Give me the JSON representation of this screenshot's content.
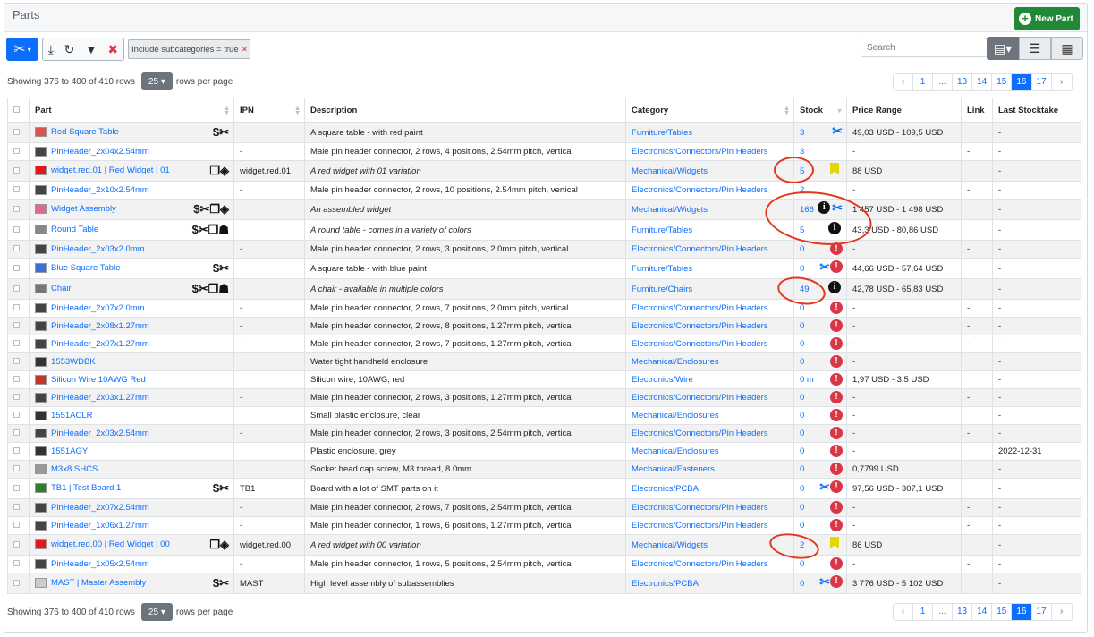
{
  "panel": {
    "title": "Parts",
    "new_part_label": "New Part"
  },
  "toolbar": {
    "filter_tag": "Include subcategories = true",
    "filter_tag_remove": "×"
  },
  "search": {
    "placeholder": "Search"
  },
  "pagination": {
    "showing_text": "Showing 376 to 400 of 410 rows",
    "page_size": "25",
    "rows_per_page_label": "rows per page",
    "pages": [
      "‹",
      "1",
      "...",
      "13",
      "14",
      "15",
      "16",
      "17",
      "›"
    ],
    "active_page": "16"
  },
  "columns": [
    "Part",
    "IPN",
    "Description",
    "Category",
    "Stock",
    "Price Range",
    "Link",
    "Last Stocktake"
  ],
  "colors": {
    "accent": "#0d6efd",
    "success": "#218838",
    "danger": "#dc3545",
    "annotation": "#e2371b"
  },
  "rows": [
    {
      "name": "Red Square Table",
      "icons": "$✂",
      "ipn": "",
      "desc": "A square table - with red paint",
      "italic": false,
      "cat": "Furniture/Tables",
      "stock": "3",
      "sicons": [
        "tool"
      ],
      "price": "49,03 USD - 109,5 USD",
      "link": "",
      "last": "-",
      "thumb": "#d9534f"
    },
    {
      "name": "PinHeader_2x04x2.54mm",
      "icons": "",
      "ipn": "-",
      "desc": "Male pin header connector, 2 rows, 4 positions, 2.54mm pitch, vertical",
      "italic": false,
      "cat": "Electronics/Connectors/Pin Headers",
      "stock": "3",
      "sicons": [],
      "price": "-",
      "link": "-",
      "last": "-",
      "thumb": "#444"
    },
    {
      "name": "widget.red.01 | Red Widget | 01",
      "icons": "❐◈",
      "ipn": "widget.red.01",
      "desc": "A red widget with 01 variation",
      "italic": true,
      "cat": "Mechanical/Widgets",
      "stock": "5",
      "sicons": [
        "flag"
      ],
      "price": "88 USD",
      "link": "",
      "last": "-",
      "thumb": "#e8141b"
    },
    {
      "name": "PinHeader_2x10x2.54mm",
      "icons": "",
      "ipn": "-",
      "desc": "Male pin header connector, 2 rows, 10 positions, 2.54mm pitch, vertical",
      "italic": false,
      "cat": "Electronics/Connectors/Pin Headers",
      "stock": "2",
      "sicons": [],
      "price": "-",
      "link": "-",
      "last": "-",
      "thumb": "#444"
    },
    {
      "name": "Widget Assembly",
      "icons": "$✂❐◈",
      "ipn": "",
      "desc": "An assembled widget",
      "italic": true,
      "cat": "Mechanical/Widgets",
      "stock": "166",
      "sicons": [
        "info",
        "tool"
      ],
      "price": "1 457 USD - 1 498 USD",
      "link": "",
      "last": "-",
      "thumb": "#d96c8a"
    },
    {
      "name": "Round Table",
      "icons": "$✂❐☗",
      "ipn": "",
      "desc": "A round table - comes in a variety of colors",
      "italic": true,
      "cat": "Furniture/Tables",
      "stock": "5",
      "sicons": [
        "info"
      ],
      "price": "43,3 USD - 80,86 USD",
      "link": "",
      "last": "-",
      "thumb": "#888"
    },
    {
      "name": "PinHeader_2x03x2.0mm",
      "icons": "",
      "ipn": "-",
      "desc": "Male pin header connector, 2 rows, 3 positions, 2.0mm pitch, vertical",
      "italic": false,
      "cat": "Electronics/Connectors/Pin Headers",
      "stock": "0",
      "sicons": [
        "warn"
      ],
      "price": "-",
      "link": "-",
      "last": "-",
      "thumb": "#444"
    },
    {
      "name": "Blue Square Table",
      "icons": "$✂",
      "ipn": "",
      "desc": "A square table - with blue paint",
      "italic": false,
      "cat": "Furniture/Tables",
      "stock": "0",
      "sicons": [
        "tool",
        "warn"
      ],
      "price": "44,66 USD - 57,64 USD",
      "link": "",
      "last": "-",
      "thumb": "#3a6fd8"
    },
    {
      "name": "Chair",
      "icons": "$✂❐☗",
      "ipn": "",
      "desc": "A chair - available in multiple colors",
      "italic": true,
      "cat": "Furniture/Chairs",
      "stock": "49",
      "sicons": [
        "info"
      ],
      "price": "42,78 USD - 65,83 USD",
      "link": "",
      "last": "-",
      "thumb": "#777"
    },
    {
      "name": "PinHeader_2x07x2.0mm",
      "icons": "",
      "ipn": "-",
      "desc": "Male pin header connector, 2 rows, 7 positions, 2.0mm pitch, vertical",
      "italic": false,
      "cat": "Electronics/Connectors/Pin Headers",
      "stock": "0",
      "sicons": [
        "warn"
      ],
      "price": "-",
      "link": "-",
      "last": "-",
      "thumb": "#444"
    },
    {
      "name": "PinHeader_2x08x1.27mm",
      "icons": "",
      "ipn": "-",
      "desc": "Male pin header connector, 2 rows, 8 positions, 1.27mm pitch, vertical",
      "italic": false,
      "cat": "Electronics/Connectors/Pin Headers",
      "stock": "0",
      "sicons": [
        "warn"
      ],
      "price": "-",
      "link": "-",
      "last": "-",
      "thumb": "#444"
    },
    {
      "name": "PinHeader_2x07x1.27mm",
      "icons": "",
      "ipn": "-",
      "desc": "Male pin header connector, 2 rows, 7 positions, 1.27mm pitch, vertical",
      "italic": false,
      "cat": "Electronics/Connectors/Pin Headers",
      "stock": "0",
      "sicons": [
        "warn"
      ],
      "price": "-",
      "link": "-",
      "last": "-",
      "thumb": "#444"
    },
    {
      "name": "1553WDBK",
      "icons": "",
      "ipn": "",
      "desc": "Water tight handheld enclosure",
      "italic": false,
      "cat": "Mechanical/Enclosures",
      "stock": "0",
      "sicons": [
        "warn"
      ],
      "price": "-",
      "link": "",
      "last": "-",
      "thumb": "#333"
    },
    {
      "name": "Silicon Wire 10AWG Red",
      "icons": "",
      "ipn": "",
      "desc": "Silicon wire, 10AWG, red",
      "italic": false,
      "cat": "Electronics/Wire",
      "stock": "0 m",
      "sicons": [
        "warn"
      ],
      "price": "1,97 USD - 3,5 USD",
      "link": "",
      "last": "-",
      "thumb": "#c0392b"
    },
    {
      "name": "PinHeader_2x03x1.27mm",
      "icons": "",
      "ipn": "-",
      "desc": "Male pin header connector, 2 rows, 3 positions, 1.27mm pitch, vertical",
      "italic": false,
      "cat": "Electronics/Connectors/Pin Headers",
      "stock": "0",
      "sicons": [
        "warn"
      ],
      "price": "-",
      "link": "-",
      "last": "-",
      "thumb": "#444"
    },
    {
      "name": "1551ACLR",
      "icons": "",
      "ipn": "",
      "desc": "Small plastic enclosure, clear",
      "italic": false,
      "cat": "Mechanical/Enclosures",
      "stock": "0",
      "sicons": [
        "warn"
      ],
      "price": "-",
      "link": "",
      "last": "-",
      "thumb": "#333"
    },
    {
      "name": "PinHeader_2x03x2.54mm",
      "icons": "",
      "ipn": "-",
      "desc": "Male pin header connector, 2 rows, 3 positions, 2.54mm pitch, vertical",
      "italic": false,
      "cat": "Electronics/Connectors/Pin Headers",
      "stock": "0",
      "sicons": [
        "warn"
      ],
      "price": "-",
      "link": "-",
      "last": "-",
      "thumb": "#444"
    },
    {
      "name": "1551AGY",
      "icons": "",
      "ipn": "",
      "desc": "Plastic enclosure, grey",
      "italic": false,
      "cat": "Mechanical/Enclosures",
      "stock": "0",
      "sicons": [
        "warn"
      ],
      "price": "-",
      "link": "",
      "last": "2022-12-31",
      "thumb": "#333"
    },
    {
      "name": "M3x8 SHCS",
      "icons": "",
      "ipn": "",
      "desc": "Socket head cap screw, M3 thread, 8.0mm",
      "italic": false,
      "cat": "Mechanical/Fasteners",
      "stock": "0",
      "sicons": [
        "warn"
      ],
      "price": "0,7799 USD",
      "link": "",
      "last": "-",
      "thumb": "#999"
    },
    {
      "name": "TB1 | Test Board 1",
      "icons": "$✂",
      "ipn": "TB1",
      "desc": "Board with a lot of SMT parts on it",
      "italic": false,
      "cat": "Electronics/PCBA",
      "stock": "0",
      "sicons": [
        "tool",
        "warn"
      ],
      "price": "97,56 USD - 307,1 USD",
      "link": "",
      "last": "-",
      "thumb": "#2e7d32"
    },
    {
      "name": "PinHeader_2x07x2.54mm",
      "icons": "",
      "ipn": "-",
      "desc": "Male pin header connector, 2 rows, 7 positions, 2.54mm pitch, vertical",
      "italic": false,
      "cat": "Electronics/Connectors/Pin Headers",
      "stock": "0",
      "sicons": [
        "warn"
      ],
      "price": "-",
      "link": "-",
      "last": "-",
      "thumb": "#444"
    },
    {
      "name": "PinHeader_1x06x1.27mm",
      "icons": "",
      "ipn": "-",
      "desc": "Male pin header connector, 1 rows, 6 positions, 1.27mm pitch, vertical",
      "italic": false,
      "cat": "Electronics/Connectors/Pin Headers",
      "stock": "0",
      "sicons": [
        "warn"
      ],
      "price": "-",
      "link": "-",
      "last": "-",
      "thumb": "#444"
    },
    {
      "name": "widget.red.00 | Red Widget | 00",
      "icons": "❐◈",
      "ipn": "widget.red.00",
      "desc": "A red widget with 00 variation",
      "italic": true,
      "cat": "Mechanical/Widgets",
      "stock": "2",
      "sicons": [
        "flag"
      ],
      "price": "86 USD",
      "link": "",
      "last": "-",
      "thumb": "#e8141b"
    },
    {
      "name": "PinHeader_1x05x2.54mm",
      "icons": "",
      "ipn": "-",
      "desc": "Male pin header connector, 1 rows, 5 positions, 2.54mm pitch, vertical",
      "italic": false,
      "cat": "Electronics/Connectors/Pin Headers",
      "stock": "0",
      "sicons": [
        "warn"
      ],
      "price": "-",
      "link": "-",
      "last": "-",
      "thumb": "#444"
    },
    {
      "name": "MAST | Master Assembly",
      "icons": "$✂",
      "ipn": "MAST",
      "desc": "High level assembly of subassemblies",
      "italic": false,
      "cat": "Electronics/PCBA",
      "stock": "0",
      "sicons": [
        "tool",
        "warn"
      ],
      "price": "3 776 USD - 5 102 USD",
      "link": "",
      "last": "-",
      "thumb": "#ccc"
    }
  ]
}
